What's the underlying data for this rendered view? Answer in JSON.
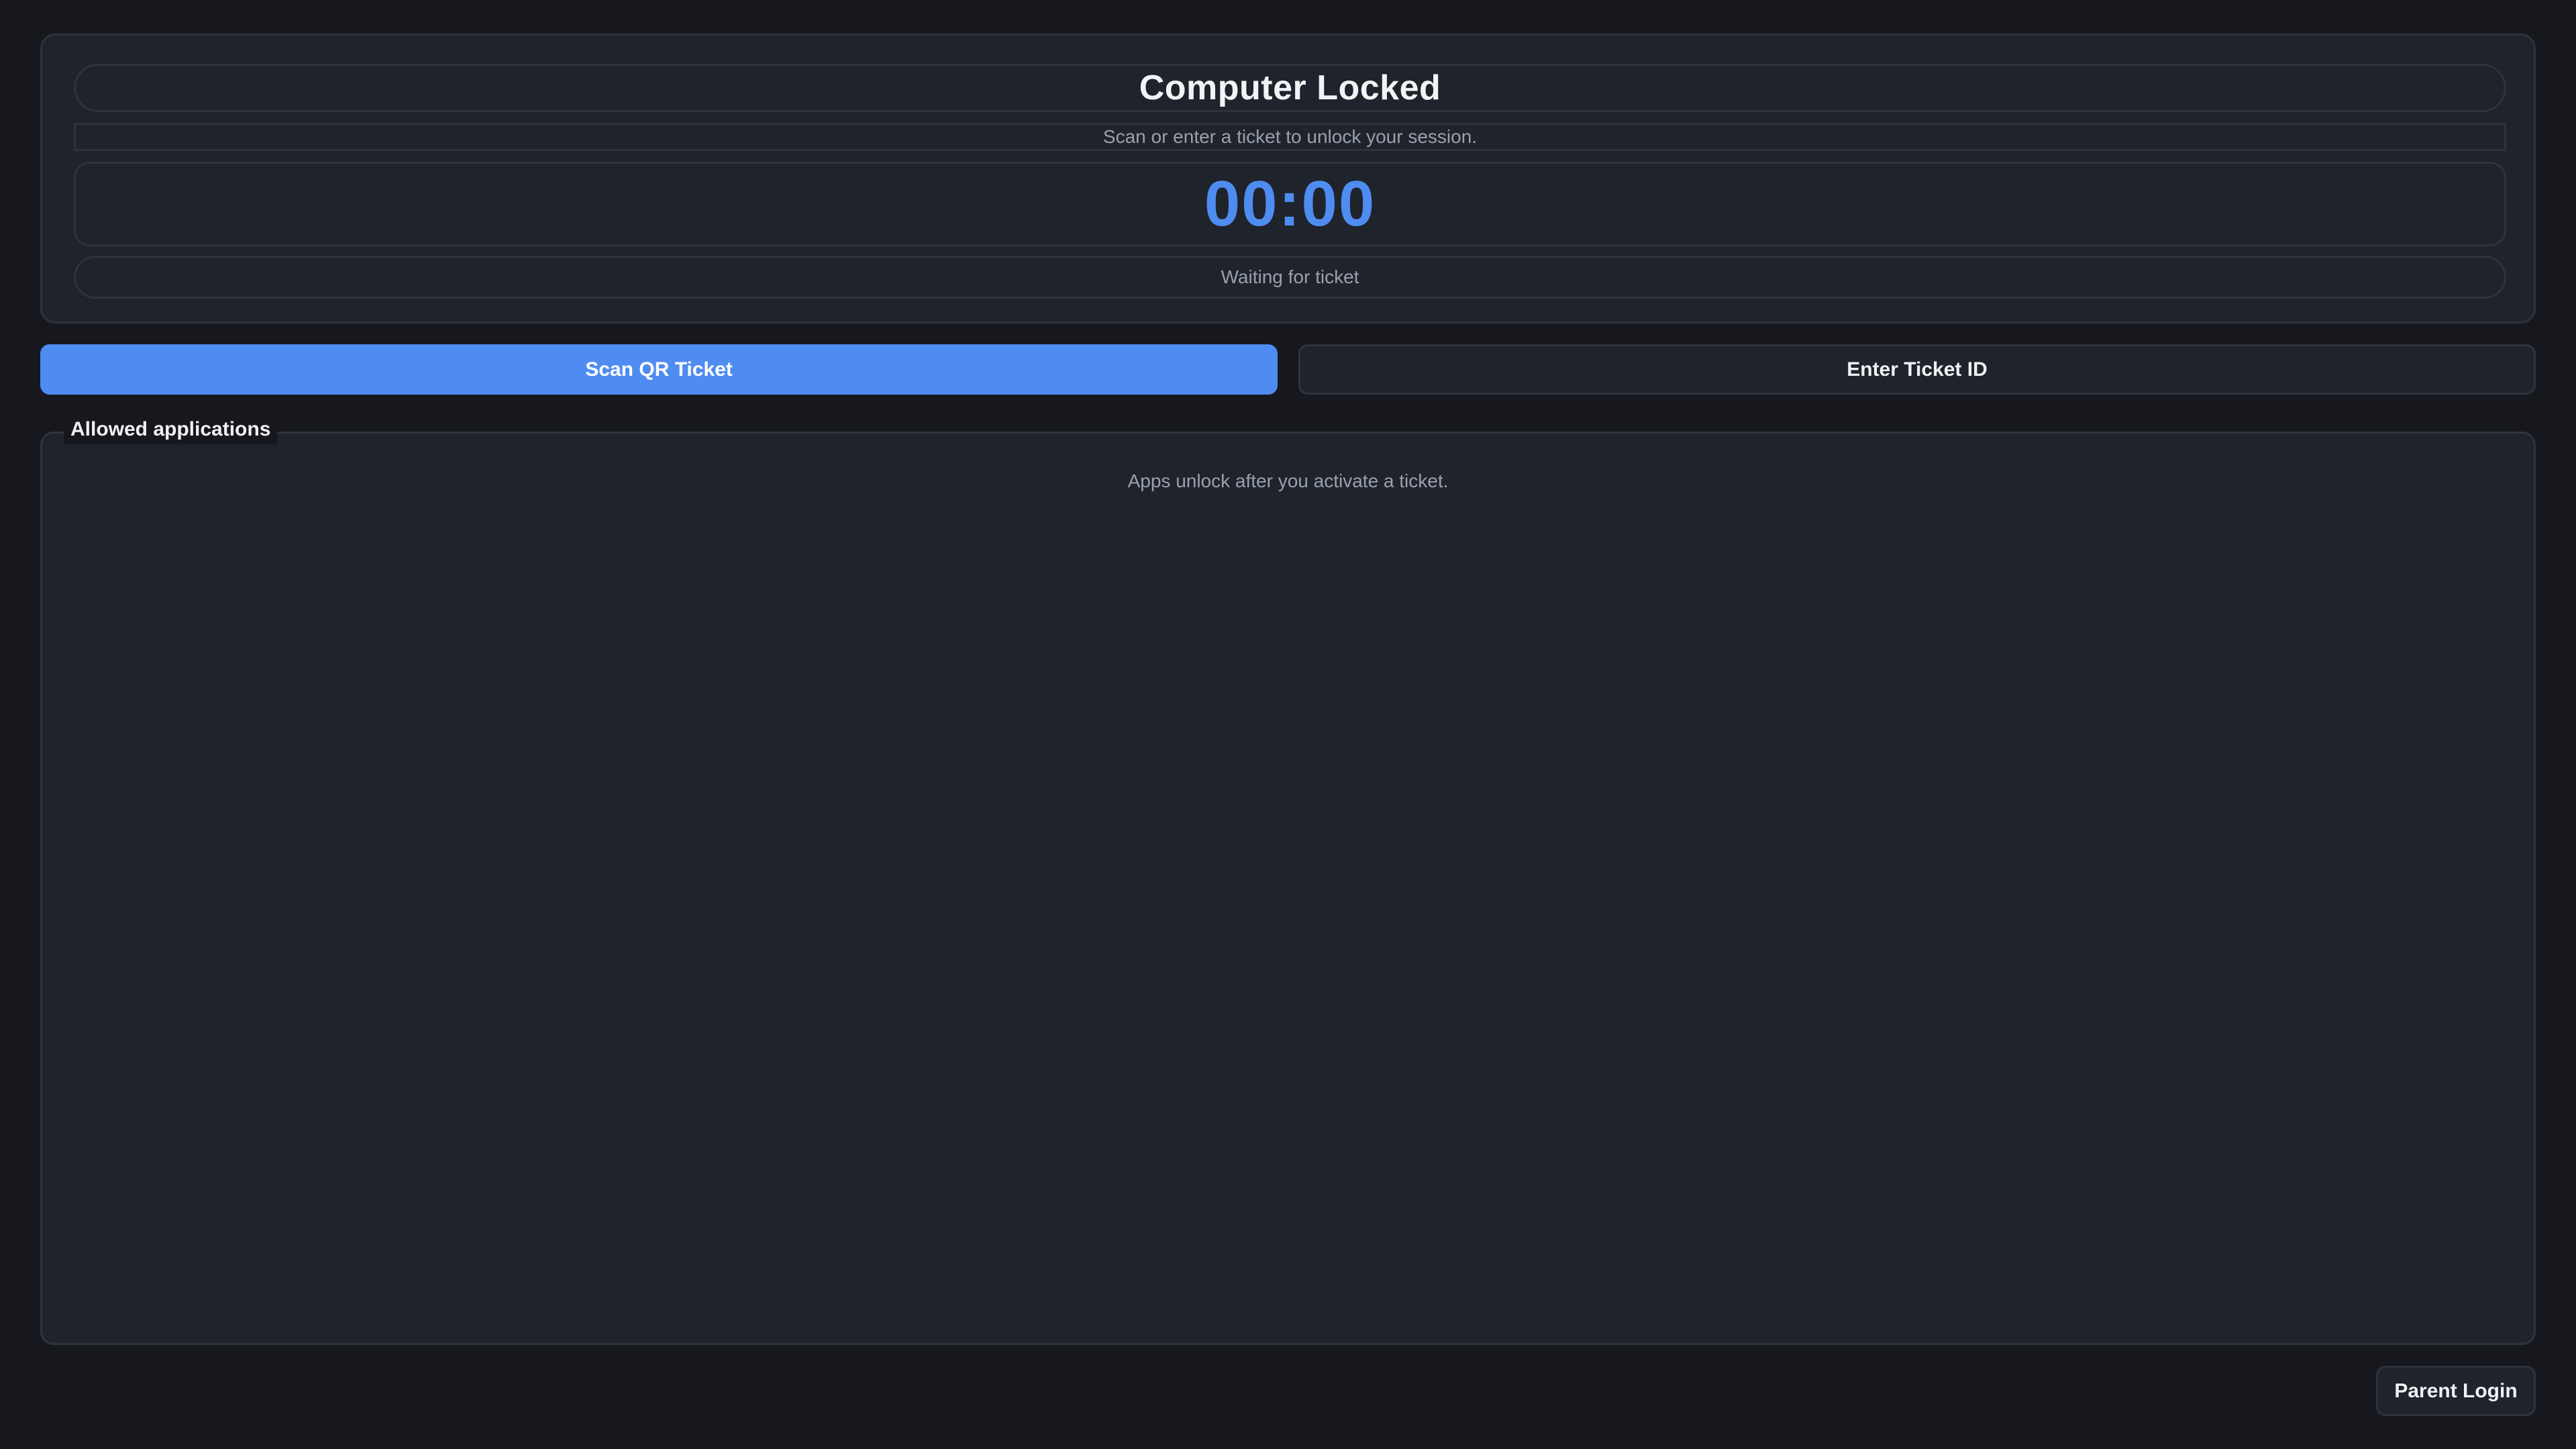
{
  "lock": {
    "title": "Computer Locked",
    "subtitle": "Scan or enter a ticket to unlock your session.",
    "timer": "00:00",
    "status": "Waiting for ticket"
  },
  "actions": {
    "scan_label": "Scan QR Ticket",
    "enter_label": "Enter Ticket ID"
  },
  "apps": {
    "heading": "Allowed applications",
    "empty_message": "Apps unlock after you activate a ticket.",
    "items": []
  },
  "footer": {
    "parent_login_label": "Parent Login"
  },
  "colors": {
    "background": "#16181d",
    "panel": "#1f232b",
    "border": "#2e333c",
    "accent": "#4f8cf2",
    "timer": "#4f8cf0",
    "muted_text": "#9aa1ad"
  }
}
